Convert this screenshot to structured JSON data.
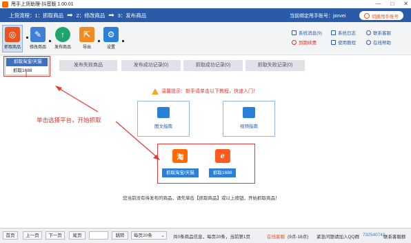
{
  "window": {
    "title": "甩手上货助理-抖音版 1.00.01",
    "controls": [
      "—",
      "□",
      "✕"
    ]
  },
  "flow": {
    "step1": "上货流程：1：抓取商品",
    "step2": "2：修改商品",
    "step3": "3：发布商品",
    "account": "当前绑定甩手账号：janvei",
    "switch_label": "切换甩手账号"
  },
  "toolbar": {
    "tools": [
      {
        "label": "抓取商品",
        "icon": "target-icon",
        "color": "#e8531f"
      },
      {
        "label": "修改商品",
        "icon": "pencil-icon",
        "color": "#3f7fd6"
      },
      {
        "label": "发布商品",
        "icon": "upload-icon",
        "color": "#1fa56b"
      },
      {
        "label": "导出",
        "icon": "export-icon",
        "color": "#f08a24"
      },
      {
        "label": "设置",
        "icon": "gear-icon",
        "color": "#2a80d8"
      }
    ],
    "links": {
      "sys_msg": "系统消息(9)",
      "sys_log": "系统日志",
      "contact": "联系客服",
      "daily": "到期续费",
      "tutorial": "使用教程",
      "online_help": "在线帮助"
    }
  },
  "dropdown": {
    "options": [
      "抓取淘宝/天猫",
      "抓取1688"
    ]
  },
  "tabs": [
    "发布失败商品",
    "发布成功记录(0)",
    "抓取成功记录(0)",
    "抓取失败记录(0)"
  ],
  "hint": "温馨提示：新手请单击以下教程，快速入门！",
  "guides": {
    "doc": "图文指南",
    "video": "视频指南"
  },
  "platforms": {
    "taobao_btn": "抓取淘宝/天猫",
    "alibaba_btn": "抓取1688",
    "taobao_glyph": "淘",
    "alibaba_glyph": "ℯ"
  },
  "annotation": "单击选择平台，开始抓取",
  "empty_note": "您当前没有待发布的商品，请先单击【抓取商品】或以上按钮，开始抓取商品！",
  "pager": {
    "first": "首页",
    "prev": "上一页",
    "next": "下一页",
    "last": "尾页",
    "go": "跳转",
    "per_page": "每页20条",
    "summary": "共0条商品信息，每页20条，当前第1页",
    "on_duty": "在线客服",
    "hours": "(9点-18点)",
    "qq_group": "紧急问题请加入QQ群",
    "qq_number": "732540742",
    "contact_mgr": "联系客服群"
  },
  "colors": {
    "primary": "#2a5ba8",
    "accent": "#e53935",
    "button": "#2a80d8"
  }
}
